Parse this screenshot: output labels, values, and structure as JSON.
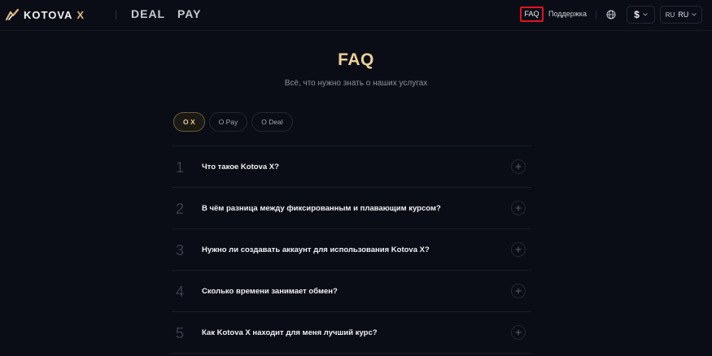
{
  "header": {
    "logo_text": "KOTOVA",
    "logo_x": "X",
    "nav": [
      {
        "label": "DEAL"
      },
      {
        "label": "PAY"
      }
    ],
    "faq_label": "FAQ",
    "support_label": "Поддержка",
    "globe_icon": "globe-icon",
    "currency_symbol": "$",
    "lang_code_small": "RU",
    "lang_code": "RU"
  },
  "colors": {
    "background": "#0a0d16",
    "accent_gold": "#ecd09a",
    "highlight_red": "#e0141e"
  },
  "hero": {
    "title": "FAQ",
    "subtitle": "Всё, что нужно знать о наших услугах"
  },
  "tabs": [
    {
      "label": "О X",
      "active": true
    },
    {
      "label": "О Pay",
      "active": false
    },
    {
      "label": "О Deal",
      "active": false
    }
  ],
  "faq": [
    {
      "num": "1",
      "question": "Что такое Kotova X?"
    },
    {
      "num": "2",
      "question": "В чём разница между фиксированным и плавающим курсом?"
    },
    {
      "num": "3",
      "question": "Нужно ли создавать аккаунт для использования Kotova X?"
    },
    {
      "num": "4",
      "question": "Сколько времени занимает обмен?"
    },
    {
      "num": "5",
      "question": "Как Kotova X находит для меня лучший курс?"
    }
  ]
}
